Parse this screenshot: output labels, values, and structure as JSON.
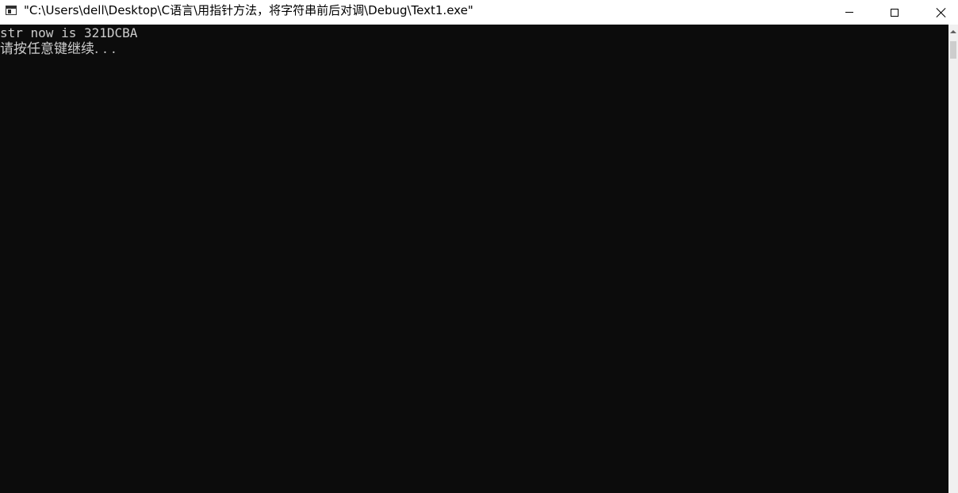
{
  "window": {
    "title": "\"C:\\Users\\dell\\Desktop\\C语言\\用指针方法，将字符串前后对调\\Debug\\Text1.exe\""
  },
  "controls": {
    "minimize_icon": "minimize-icon",
    "maximize_icon": "maximize-icon",
    "close_icon": "close-icon"
  },
  "console": {
    "lines": [
      "str now is 321DCBA",
      "请按任意键继续. . ."
    ],
    "background": "#0c0c0c",
    "text_color": "#cccccc"
  }
}
